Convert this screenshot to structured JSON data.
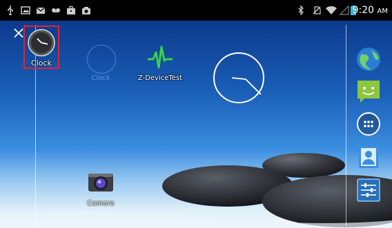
{
  "status_bar": {
    "time": "9:20",
    "am_pm": "AM",
    "left_icons": [
      "usb-icon",
      "gallery-icon",
      "gmail-icon",
      "voicemail-icon",
      "briefcase-icon",
      "camera-notification-icon"
    ],
    "right_icons": [
      "bluetooth-icon",
      "no-sim-icon",
      "wifi-icon",
      "signal-icon",
      "battery-icon"
    ]
  },
  "edit_mode": {
    "close_icon": "close-icon",
    "dragged_app": {
      "label": "Clock",
      "highlight_color": "#e0242b"
    }
  },
  "home": {
    "ghost_clock_label": "Clock",
    "z_device_label": "Z-DeviceTest",
    "camera_label": "Camera",
    "analog_clock": {
      "hour": 9,
      "minute": 20
    }
  },
  "dock": {
    "items": [
      "browser-icon",
      "messaging-icon",
      "all-apps-icon",
      "contacts-icon",
      "settings-icon"
    ]
  }
}
